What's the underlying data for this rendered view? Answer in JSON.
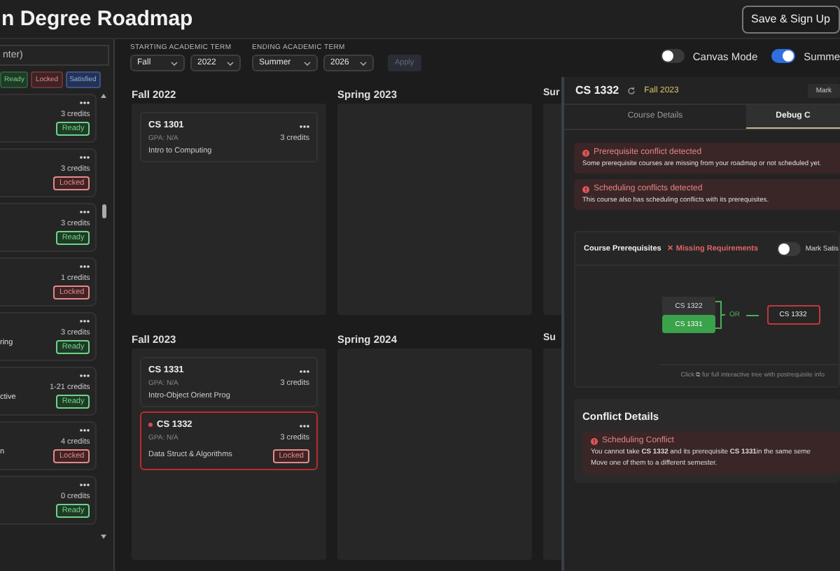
{
  "header": {
    "title": "n Degree Roadmap",
    "save_button": "Save & Sign Up"
  },
  "sidebar": {
    "search": {
      "placeholder": "nter)"
    },
    "filters": [
      {
        "label": "Ready",
        "kind": "ready"
      },
      {
        "label": "Locked",
        "kind": "locked"
      },
      {
        "label": "Satisfied",
        "kind": "satisfied"
      }
    ],
    "items": [
      {
        "credits": "3 credits",
        "status": {
          "label": "Ready",
          "kind": "ready"
        }
      },
      {
        "credits": "3 credits",
        "status": {
          "label": "Locked",
          "kind": "locked"
        }
      },
      {
        "credits": "3 credits",
        "status": {
          "label": "Ready",
          "kind": "ready"
        }
      },
      {
        "credits": "1 credits",
        "status": {
          "label": "Locked",
          "kind": "locked"
        }
      },
      {
        "text": "ring",
        "credits": "3 credits",
        "status": {
          "label": "Ready",
          "kind": "ready"
        }
      },
      {
        "text": "ctive",
        "credits": "1-21 credits",
        "status": {
          "label": "Ready",
          "kind": "ready"
        }
      },
      {
        "text": "n",
        "credits": "4 credits",
        "status": {
          "label": "Locked",
          "kind": "locked"
        }
      },
      {
        "credits": "0 credits",
        "status": {
          "label": "Ready",
          "kind": "ready"
        }
      }
    ]
  },
  "toolbar": {
    "start_label": "STARTING ACADEMIC TERM",
    "start_term": "Fall",
    "start_year": "2022",
    "end_label": "ENDING ACADEMIC TERM",
    "end_term": "Summer",
    "end_year": "2026",
    "apply_button": {
      "label": "Apply",
      "disabled": true
    },
    "toggles": [
      {
        "label": "Canvas Mode",
        "on": false
      },
      {
        "label": "Summe",
        "on": true
      }
    ]
  },
  "semesters": [
    [
      {
        "label": "Fall 2022",
        "courses": [
          {
            "code": "CS 1301",
            "gpa": "GPA: N/A",
            "credits": "3 credits",
            "name": "Intro to Computing",
            "conflict": false
          }
        ]
      },
      {
        "label": "Spring 2023"
      },
      {
        "label": "Sur"
      }
    ],
    [
      {
        "label": "Fall 2023",
        "courses": [
          {
            "code": "CS 1331",
            "gpa": "GPA: N/A",
            "credits": "3 credits",
            "name": "Intro-Object Orient Prog",
            "conflict": false
          },
          {
            "code": "CS 1332",
            "gpa": "GPA: N/A",
            "credits": "3 credits",
            "name": "Data Struct & Algorithms",
            "conflict": true,
            "status": {
              "label": "Locked",
              "kind": "locked"
            }
          }
        ]
      },
      {
        "label": "Spring 2024"
      },
      {
        "label": "Su"
      }
    ]
  ],
  "detail": {
    "code": "CS 1332",
    "term": "Fall 2023",
    "mark_button": "Mark",
    "tabs": [
      {
        "label": "Course Details",
        "selected": false
      },
      {
        "label": "Debug C",
        "selected": true
      }
    ],
    "alerts": [
      {
        "title": "Prerequisite conflict detected",
        "text": "Some prerequisite courses are missing from your roadmap or not scheduled yet."
      },
      {
        "title": "Scheduling conflicts detected",
        "text": "This course also has scheduling conflicts with its prerequisites."
      }
    ],
    "prerequisites": {
      "title": "Course Prerequisites",
      "status": "✕ Missing Requirements",
      "mark_toggle": {
        "label": "Mark Satis",
        "on": false
      },
      "options": [
        {
          "code": "CS 1322",
          "satisfied": false
        },
        {
          "code": "CS 1331",
          "satisfied": true
        }
      ],
      "connector": "OR",
      "target": "CS 1332",
      "hint": "Click ⧉ for full interactive tree with postrequisite info"
    },
    "conflicts": {
      "title": "Conflict Details",
      "items": [
        {
          "title": "Scheduling Conflict",
          "lines": [
            "You cannot take **CS 1332** and its prerequisite **CS 1331**in the same seme",
            "Move one of them to a different semester."
          ]
        }
      ]
    }
  }
}
